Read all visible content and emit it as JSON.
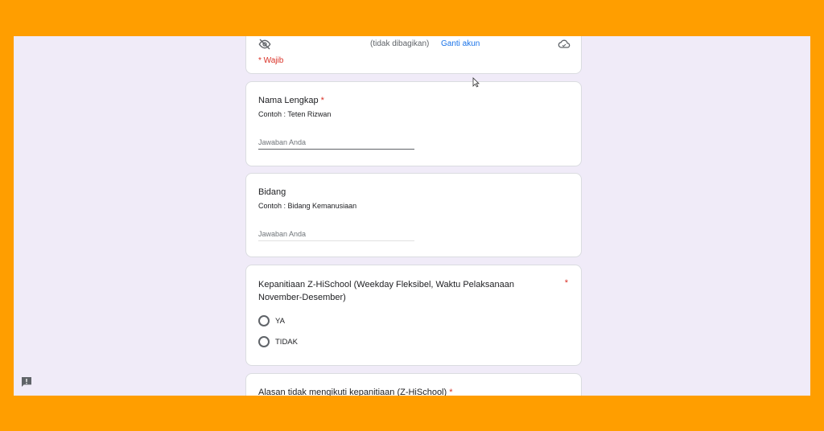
{
  "header": {
    "email": "",
    "not_shared": "(tidak dibagikan)",
    "switch_account": "Ganti akun",
    "required_note": "* Wajib",
    "icons": [
      "eye-off-icon",
      "cloud-icon"
    ]
  },
  "questions": {
    "nama": {
      "title": "Nama Lengkap",
      "required_mark": "*",
      "description": "Contoh : Teten Rizwan",
      "placeholder": "Jawaban Anda"
    },
    "bidang": {
      "title": "Bidang",
      "description": "Contoh : Bidang Kemanusiaan",
      "placeholder": "Jawaban Anda"
    },
    "kepanitiaan": {
      "title": "Kepanitiaan Z-HiSchool (Weekday Fleksibel, Waktu Pelaksanaan November-Desember)",
      "required_mark": "*",
      "options": [
        "YA",
        "TIDAK"
      ]
    },
    "alasan": {
      "title": "Alasan tidak mengikuti kepanitiaan (Z-HiSchool)",
      "required_mark": "*"
    }
  },
  "colors": {
    "frame": "#FF9E00",
    "background": "#F0EBF8",
    "required": "#d93025",
    "link": "#1a73e8"
  }
}
